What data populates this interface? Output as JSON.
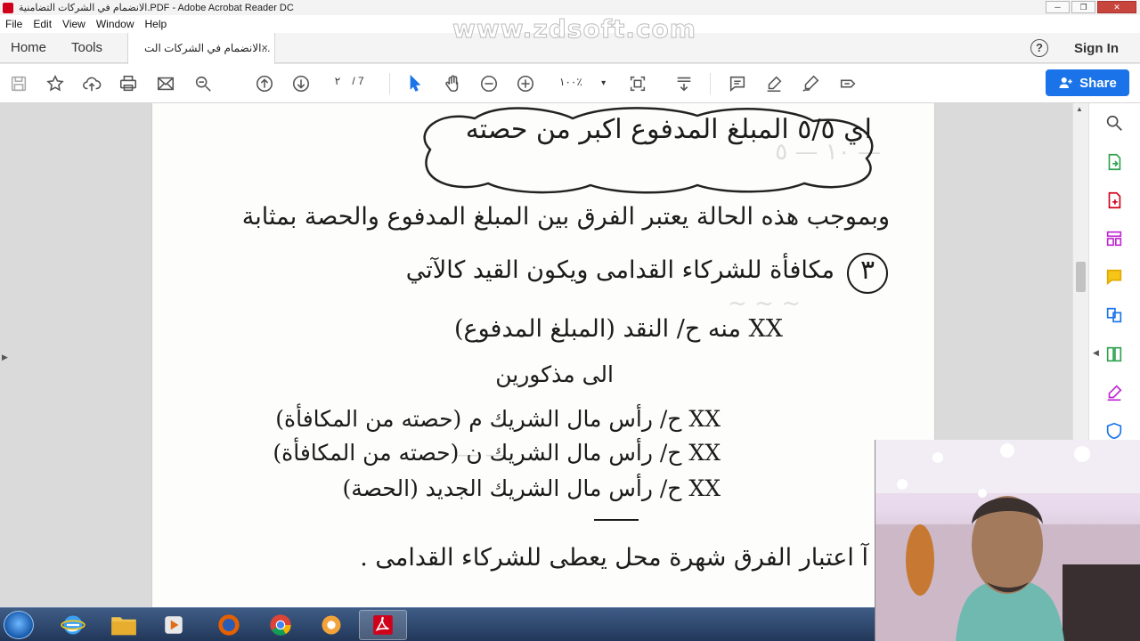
{
  "window": {
    "title": "الانضمام في الشركات التضامنية.PDF - Adobe Acrobat Reader DC",
    "watermark": "www.zdsoft.com",
    "minimize": "─",
    "maximize": "❐",
    "close": "✕"
  },
  "menu": [
    "File",
    "Edit",
    "View",
    "Window",
    "Help"
  ],
  "tabs": {
    "home": "Home",
    "tools": "Tools",
    "document": "الانضمام في الشركات الت...",
    "close": "×"
  },
  "header": {
    "help": "?",
    "signin": "Sign In"
  },
  "toolbar": {
    "page_current": "٢",
    "page_total": "/ 7",
    "zoom": "١٠٠٪",
    "zoom_arrow": "▾",
    "share": "Share"
  },
  "document": {
    "lines": [
      "اي ٥/٥ المبلغ المدفوع اكبر من حصته",
      "وبموجب هذه الحالة يعتبر الفرق بين المبلغ المدفوع والحصة بمثابة",
      "مكافأة للشركاء القدامى ويكون القيد كالآتي",
      "٣",
      "XX منه ح/ النقد (المبلغ المدفوع)",
      "الى مذكورين",
      "XX ح/ رأس مال الشريك م (حصته من المكافأة)",
      "XX ح/ رأس مال الشريك ن (حصته من المكافأة)",
      "XX ح/ رأس مال الشريك الجديد (الحصة)",
      "ب آ اعتبار الفرق شهرة محل يعطى للشركاء القدامى ."
    ]
  },
  "colors": {
    "accent": "#1a73e8",
    "close": "#c7453c",
    "pdf_red": "#d0021b"
  }
}
